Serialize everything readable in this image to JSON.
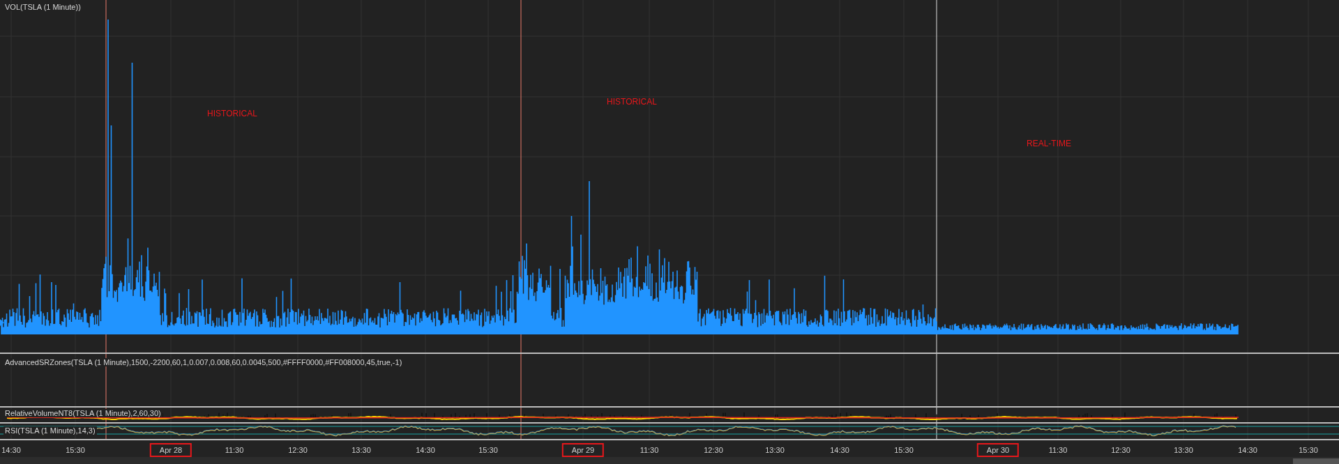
{
  "panels": [
    {
      "kind": "volume",
      "title": "VOL(TSLA (1 Minute))",
      "annotations": [
        "HISTORICAL",
        "HISTORICAL",
        "REAL-TIME"
      ]
    },
    {
      "kind": "zones",
      "title": "AdvancedSRZones(TSLA (1 Minute),1500,-2200,60,1,0.007,0.008,60,0.0045,500,#FFFF0000,#FF008000,45,true,-1)"
    },
    {
      "kind": "relvol",
      "title": "RelativeVolumeNT8(TSLA (1 Minute),2,60,30)"
    },
    {
      "kind": "oscillator",
      "title": "RSI(TSLA (1 Minute),14,3)"
    }
  ],
  "time_axis": [
    {
      "label": "14:30",
      "highlighted": false
    },
    {
      "label": "15:30",
      "highlighted": false
    },
    {
      "label": "Apr 28",
      "highlighted": true
    },
    {
      "label": "11:30",
      "highlighted": false
    },
    {
      "label": "12:30",
      "highlighted": false
    },
    {
      "label": "13:30",
      "highlighted": false
    },
    {
      "label": "14:30",
      "highlighted": false
    },
    {
      "label": "15:30",
      "highlighted": false
    },
    {
      "label": "Apr 29",
      "highlighted": true
    },
    {
      "label": "11:30",
      "highlighted": false
    },
    {
      "label": "12:30",
      "highlighted": false
    },
    {
      "label": "13:30",
      "highlighted": false
    },
    {
      "label": "14:30",
      "highlighted": false
    },
    {
      "label": "15:30",
      "highlighted": false
    },
    {
      "label": "Apr 30",
      "highlighted": true
    },
    {
      "label": "11:30",
      "highlighted": false
    },
    {
      "label": "12:30",
      "highlighted": false
    },
    {
      "label": "13:30",
      "highlighted": false
    },
    {
      "label": "14:30",
      "highlighted": false
    },
    {
      "label": "15:30",
      "highlighted": false
    }
  ]
}
